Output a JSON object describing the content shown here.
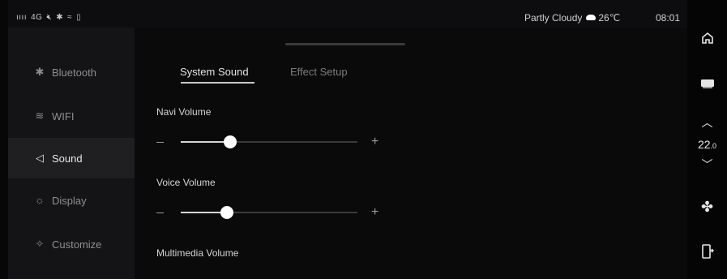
{
  "status_bar": {
    "signal_text": "4G",
    "weather": "Partly Cloudy",
    "temperature": "26℃",
    "time": "08:01"
  },
  "sidebar": {
    "items": [
      {
        "label": "Bluetooth",
        "icon": "bluetooth-icon",
        "active": false
      },
      {
        "label": "WIFI",
        "icon": "wifi-icon",
        "active": false
      },
      {
        "label": "Sound",
        "icon": "speaker-icon",
        "active": true
      },
      {
        "label": "Display",
        "icon": "sun-icon",
        "active": false
      },
      {
        "label": "Customize",
        "icon": "customize-icon",
        "active": false
      }
    ]
  },
  "tabs": {
    "system_sound": "System Sound",
    "effect_setup": "Effect Setup",
    "active": "system_sound"
  },
  "volumes": {
    "navi": {
      "label": "Navi Volume",
      "level": 0.28
    },
    "voice": {
      "label": "Voice Volume",
      "level": 0.26
    },
    "multimedia": {
      "label": "Multimedia Volume"
    }
  },
  "right_rail": {
    "temp_whole": "22",
    "temp_decimal": ".0",
    "icons": [
      "home-icon",
      "screen-icon",
      "chevron-up-icon",
      "chevron-down-icon",
      "fan-icon",
      "door-icon"
    ]
  },
  "colors": {
    "background": "#070708",
    "sidebar": "#141416",
    "sidebar_active": "#1f1f22",
    "slider_knob": "#ffffff"
  }
}
